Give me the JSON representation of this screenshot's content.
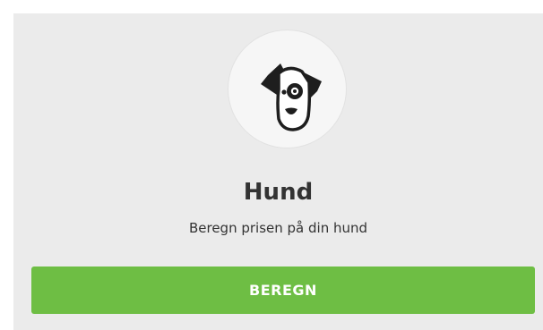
{
  "product": {
    "icon": "dog-face-icon",
    "title": "Hund",
    "subtitle": "Beregn prisen på din hund",
    "button_label": "BEREGN"
  },
  "colors": {
    "card_background": "#ebebeb",
    "button_background": "#6ebe44",
    "button_text": "#ffffff",
    "icon_dark": "#1e1e1e"
  }
}
